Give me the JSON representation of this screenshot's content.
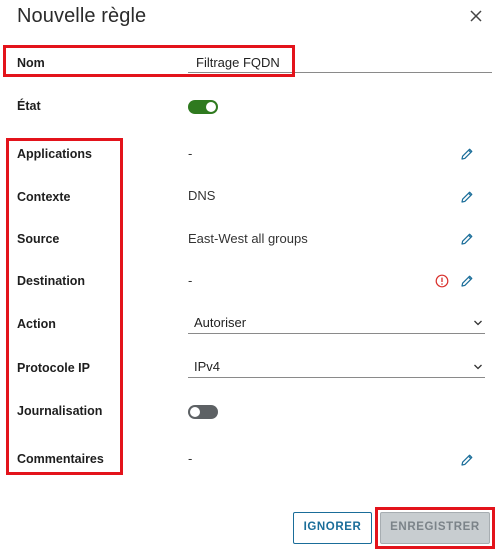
{
  "dialog": {
    "title": "Nouvelle règle",
    "close_icon": "close-icon"
  },
  "form": {
    "name": {
      "label": "Nom",
      "value": "Filtrage FQDN"
    },
    "state": {
      "label": "État",
      "enabled": true
    },
    "applications": {
      "label": "Applications",
      "value": "-"
    },
    "context": {
      "label": "Contexte",
      "value": "DNS"
    },
    "source": {
      "label": "Source",
      "value": "East-West all groups"
    },
    "destination": {
      "label": "Destination",
      "value": "-",
      "warning_icon": "alert-circle-icon"
    },
    "action": {
      "label": "Action",
      "selected": "Autoriser"
    },
    "ip_protocol": {
      "label": "Protocole IP",
      "selected": "IPv4"
    },
    "logging": {
      "label": "Journalisation",
      "enabled": false
    },
    "comments": {
      "label": "Commentaires",
      "value": "-"
    }
  },
  "buttons": {
    "ignore": "IGNORER",
    "save": "ENREGISTRER"
  },
  "colors": {
    "accent": "#1a6d99",
    "toggle_on": "#2f7a1f",
    "toggle_off": "#5d6164",
    "warning": "#d9302c",
    "highlight": "#e3131b",
    "disabled_button": "#c8cdd0"
  }
}
